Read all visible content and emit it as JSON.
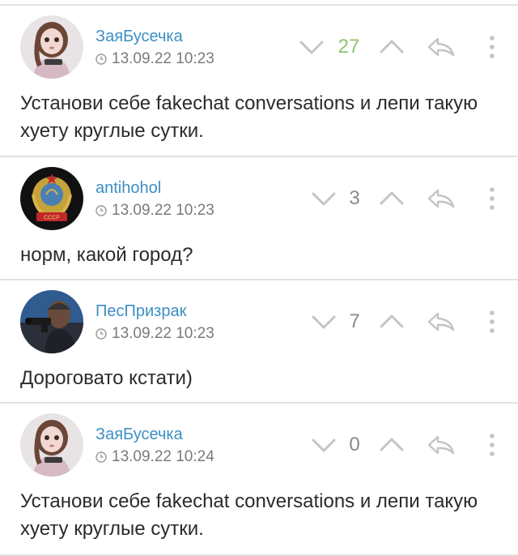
{
  "comments": [
    {
      "username": "ЗаяБусечка",
      "timestamp": "13.09.22 10:23",
      "score": "27",
      "score_positive": true,
      "text": "Установи себе fakechat conversations и лепи такую хуету круглые сутки.",
      "avatar": "girl-doll-avatar"
    },
    {
      "username": "antihohol",
      "timestamp": "13.09.22 10:23",
      "score": "3",
      "score_positive": false,
      "text": "норм, какой город?",
      "avatar": "ussr-emblem-avatar"
    },
    {
      "username": "ПесПризрак",
      "timestamp": "13.09.22 10:23",
      "score": "7",
      "score_positive": false,
      "text": "Дороговато кстати)",
      "avatar": "man-with-gun-avatar"
    },
    {
      "username": "ЗаяБусечка",
      "timestamp": "13.09.22 10:24",
      "score": "0",
      "score_positive": false,
      "text": "Установи себе fakechat conversations и лепи такую хуету круглые сутки.",
      "avatar": "girl-doll-avatar"
    }
  ],
  "colors": {
    "username": "#3d8fc4",
    "score_positive": "#8cc56b",
    "icon": "#c4c4c4",
    "divider": "#e2e2e2"
  }
}
